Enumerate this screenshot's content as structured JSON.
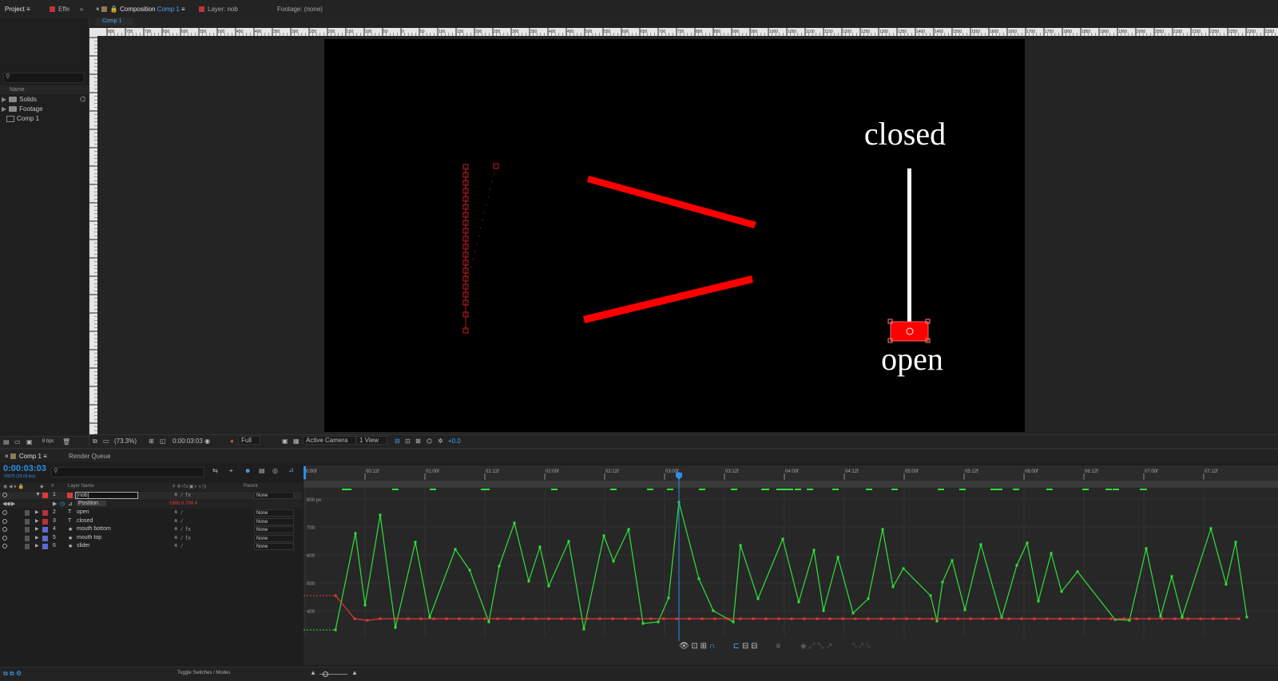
{
  "top_tabs": {
    "project": "Project",
    "effects": "Effe",
    "composition_prefix": "Composition",
    "composition_name": "Comp 1",
    "layer": "Layer: nob",
    "footage": "Footage: (none)"
  },
  "project_panel": {
    "name_header": "Name",
    "items": [
      {
        "label": "Solids",
        "type": "folder"
      },
      {
        "label": "Footage",
        "type": "folder"
      },
      {
        "label": "Comp 1",
        "type": "composition"
      }
    ],
    "bpc": "8 bpc"
  },
  "viewer": {
    "comp_tab": "Comp 1",
    "ruler_labels": [
      "800",
      "750",
      "700",
      "650",
      "600",
      "550",
      "500",
      "450",
      "400",
      "350",
      "300",
      "250",
      "200",
      "150",
      "100",
      "50",
      "0",
      "50",
      "100",
      "150",
      "200",
      "250",
      "300",
      "350",
      "400",
      "450",
      "500",
      "550",
      "600",
      "650",
      "700",
      "750",
      "800",
      "850",
      "900",
      "950",
      "1000",
      "1050",
      "1100",
      "1150",
      "1200",
      "1250",
      "1300",
      "1350",
      "1400",
      "1450",
      "1500",
      "1550",
      "1600",
      "1650",
      "1700",
      "1750",
      "1800",
      "1850",
      "1900",
      "1950",
      "2000",
      "2050",
      "2100",
      "2150",
      "2200",
      "2250",
      "2300",
      "2350",
      "2400",
      "2450",
      "2500"
    ],
    "canvas_labels": {
      "closed": "closed",
      "open": "open"
    },
    "toolbar": {
      "zoom": "(73.3%)",
      "timecode": "0:00:03:03",
      "resolution": "Full",
      "camera": "Active Camera",
      "views": "1 View",
      "exposure": "+0.0"
    }
  },
  "timeline": {
    "tab_label": "Comp 1",
    "render_queue": "Render Queue",
    "timecode": "0:00:03:03",
    "fps": "00075 (24.00 fps)",
    "columns": {
      "layer_name": "Layer Name",
      "parent": "Parent"
    },
    "layers": [
      {
        "num": "1",
        "name": "[nob]",
        "type": "solid",
        "color": "#e0383e",
        "fx": true,
        "parent": "None"
      },
      {
        "num": "2",
        "name": "open",
        "type": "text",
        "color": "#b8323a",
        "fx": false,
        "parent": "None"
      },
      {
        "num": "3",
        "name": "closed",
        "type": "text",
        "color": "#b8323a",
        "fx": false,
        "parent": "None"
      },
      {
        "num": "4",
        "name": "mouth bottom",
        "type": "shape",
        "color": "#5b6bd1",
        "fx": true,
        "parent": "None"
      },
      {
        "num": "5",
        "name": "mouth top",
        "type": "shape",
        "color": "#5b6bd1",
        "fx": true,
        "parent": "None"
      },
      {
        "num": "6",
        "name": "slider",
        "type": "shape",
        "color": "#5b6bd1",
        "fx": false,
        "parent": "None"
      }
    ],
    "property": {
      "name": "Position",
      "value": "1600.0,799.4"
    },
    "time_ruler": [
      "0:00f",
      "00:12f",
      "01:00f",
      "01:12f",
      "02:00f",
      "02:12f",
      "03:00f",
      "03:12f",
      "04:00f",
      "04:12f",
      "05:00f",
      "05:12f",
      "06:00f",
      "06:12f",
      "07:00f",
      "07:12f"
    ],
    "graph_y_labels": [
      "800 px",
      "700",
      "600",
      "500",
      "400"
    ],
    "toggle_label": "Toggle Switches / Modes"
  },
  "colors": {
    "accent_blue": "#2f8ee8",
    "graph_green": "#2fe23a",
    "graph_red": "#e03a3a",
    "shape_red": "#ff0000"
  }
}
